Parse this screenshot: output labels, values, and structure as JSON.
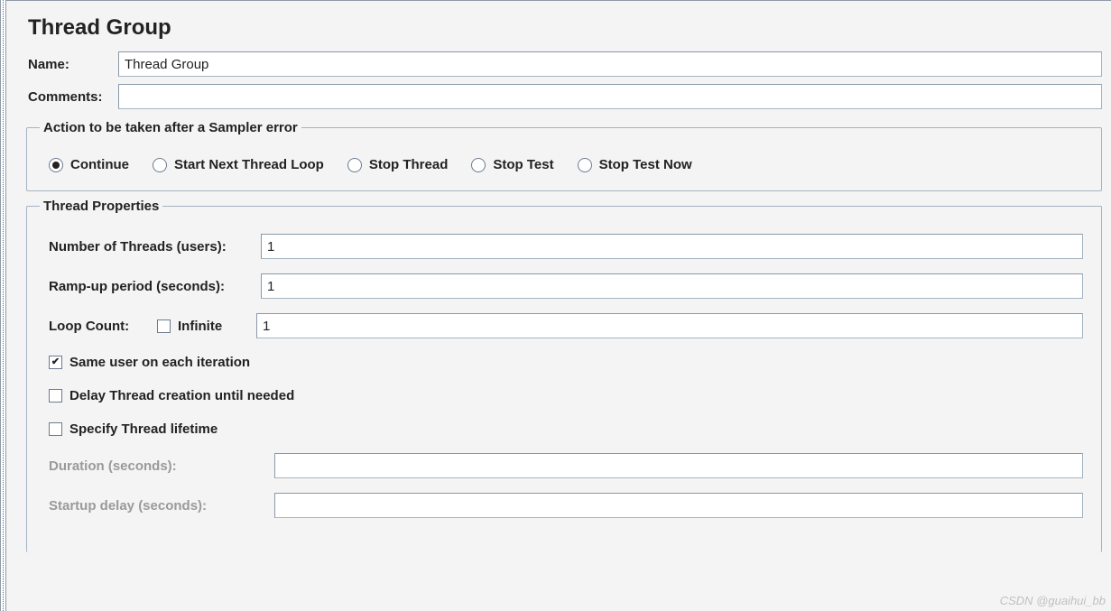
{
  "heading": "Thread Group",
  "nameRow": {
    "label": "Name:",
    "value": "Thread Group"
  },
  "commentsRow": {
    "label": "Comments:",
    "value": ""
  },
  "actionGroup": {
    "legend": "Action to be taken after a Sampler error",
    "options": {
      "continue": "Continue",
      "startNext": "Start Next Thread Loop",
      "stopThread": "Stop Thread",
      "stopTest": "Stop Test",
      "stopTestNow": "Stop Test Now"
    },
    "selected": "continue"
  },
  "threadProps": {
    "legend": "Thread Properties",
    "numThreads": {
      "label": "Number of Threads (users):",
      "value": "1"
    },
    "rampUp": {
      "label": "Ramp-up period (seconds):",
      "value": "1"
    },
    "loopCount": {
      "label": "Loop Count:",
      "infiniteLabel": "Infinite",
      "infiniteChecked": false,
      "value": "1"
    },
    "sameUser": {
      "label": "Same user on each iteration",
      "checked": true
    },
    "delayCreation": {
      "label": "Delay Thread creation until needed",
      "checked": false
    },
    "specifyLifetime": {
      "label": "Specify Thread lifetime",
      "checked": false
    },
    "duration": {
      "label": "Duration (seconds):",
      "value": ""
    },
    "startupDelay": {
      "label": "Startup delay (seconds):",
      "value": ""
    }
  },
  "watermark": "CSDN @guaihui_bb"
}
